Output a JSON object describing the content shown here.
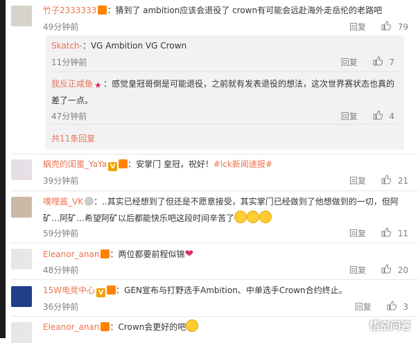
{
  "comments": [
    {
      "user": "竹子2333333",
      "text": "：猜到了 ambition应该会退役了 crown有可能会远赴海外走岳伦的老路吧",
      "time": "49分钟前",
      "reply": "回复",
      "likes": "79"
    },
    {
      "user": "蜗壳的闺蜜_YaYa",
      "text": "：安掌门 皇冠，祝好！",
      "tag": "#lck新闻速报#",
      "time": "39分钟前",
      "reply": "回复",
      "likes": "21"
    },
    {
      "user": "噗哩酱_VK",
      "text": "：..其实已经想到了但还是不愿意接受，其实掌门已经做到了他想做到的一切，但阿矿…阿矿…希望阿矿以后都能快乐吧这段时间辛苦了",
      "time": "59分钟前",
      "reply": "回复",
      "likes": "11"
    },
    {
      "user": "Eleanor_anan",
      "text": "：两位都要前程似锦",
      "time": "48分钟前",
      "reply": "回复",
      "likes": "20"
    },
    {
      "user": "15W电竞中心",
      "text": "：GEN宣布与打野选手Ambition、中单选手Crown合约终止。",
      "time": "36分钟前",
      "reply": "回复",
      "likes": "3"
    },
    {
      "user": "Eleanor_anan",
      "text": "：Crown会更好的吧",
      "time": "",
      "reply": "",
      "likes": ""
    }
  ],
  "subreplies": [
    {
      "user": "Skatch-",
      "text": "：VG Ambition VG Crown",
      "time": "11分钟前",
      "reply": "回复",
      "likes": "7"
    },
    {
      "user": "我反正咸鱼",
      "text": "：感觉皇冠哥倒是可能退役，之前就有发表退役的想法，这次世界赛状态也真的差了一点。",
      "time": "47分钟前",
      "reply": "回复",
      "likes": "4"
    }
  ],
  "more_replies": "共11条回复",
  "badge_v": "V",
  "watermark": "悟空问答",
  "colors": {
    "username": "#eb7350",
    "meta": "#808080"
  }
}
